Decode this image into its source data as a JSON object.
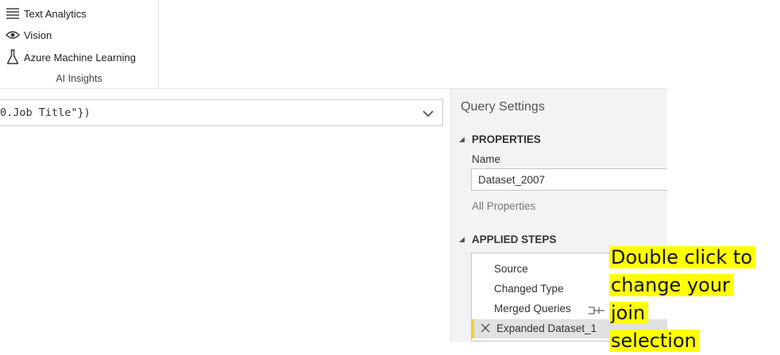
{
  "ribbon": {
    "group_label": "AI Insights",
    "buttons": [
      {
        "label": "Text Analytics",
        "icon": "list-lines-icon"
      },
      {
        "label": "Vision",
        "icon": "eye-icon"
      },
      {
        "label": "Azure Machine Learning",
        "icon": "flask-icon"
      }
    ]
  },
  "formula": {
    "text": "0.Job Title\"})"
  },
  "query_settings": {
    "title": "Query Settings",
    "properties": {
      "heading": "PROPERTIES",
      "name_label": "Name",
      "name_value": "Dataset_2007",
      "all_properties_link": "All Properties"
    },
    "applied_steps": {
      "heading": "APPLIED STEPS",
      "steps": [
        {
          "label": "Source"
        },
        {
          "label": "Changed Type"
        },
        {
          "label": "Merged Queries"
        },
        {
          "label": "Expanded Dataset_1"
        }
      ]
    }
  },
  "callout": {
    "lines": [
      "Double click to",
      "change your join",
      "selection"
    ],
    "highlight_color": "#ffff00"
  }
}
